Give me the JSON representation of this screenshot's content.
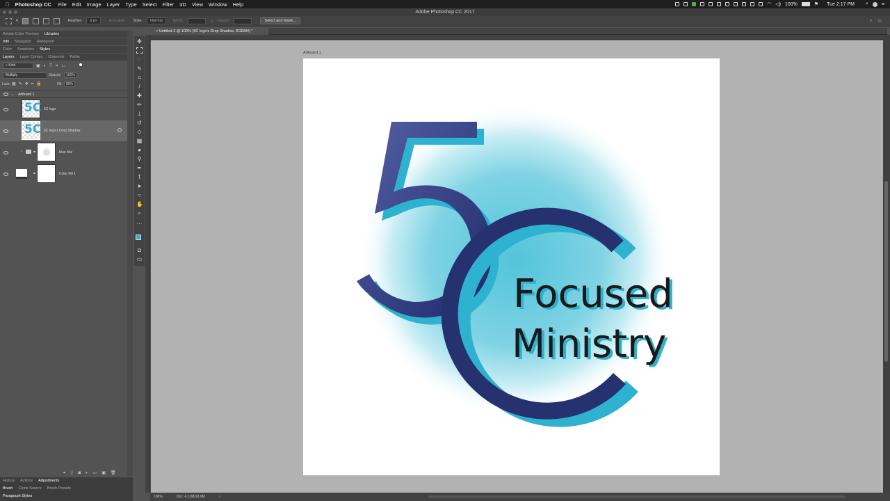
{
  "menubar": {
    "app_name": "Photoshop CC",
    "items": [
      "File",
      "Edit",
      "Image",
      "Layer",
      "Type",
      "Select",
      "Filter",
      "3D",
      "View",
      "Window",
      "Help"
    ],
    "battery": "100%",
    "clock": "Tue 2:17 PM"
  },
  "window": {
    "title": "Adobe Photoshop CC 2017"
  },
  "options_bar": {
    "feather_label": "Feather:",
    "feather_value": "0 px",
    "antialias_label": "Anti-alias",
    "style_label": "Style:",
    "style_value": "Normal",
    "width_label": "Width:",
    "height_label": "Height:",
    "select_mask_label": "Select and Mask..."
  },
  "left_panel": {
    "row1_tabs": [
      "Adobe Color Themes",
      "Libraries"
    ],
    "row2_tabs": [
      "Info",
      "Navigator",
      "Histogram"
    ],
    "row3_tabs": [
      "Color",
      "Swatches",
      "Styles"
    ],
    "row4_tabs": [
      "Layers",
      "Layer Comps",
      "Channels",
      "Paths"
    ],
    "kind_label": "Kind",
    "blend_mode": "Multiply",
    "opacity_label": "Opacity:",
    "opacity_value": "100%",
    "lock_label": "Lock:",
    "fill_label": "Fill:",
    "fill_value": "85%",
    "artboard_name": "Artboard 1",
    "layers": [
      {
        "name": "5C logo"
      },
      {
        "name": "5C logo's Drop Shadow"
      },
      {
        "name": "blue blur"
      },
      {
        "name": "Color Fill 1"
      }
    ],
    "bottom_tabs_1": [
      "History",
      "Actions",
      "Adjustments"
    ],
    "bottom_tabs_2": [
      "Brush",
      "Clone Source",
      "Brush Presets"
    ],
    "bottom_tabs_3": [
      "Paragraph Styles"
    ]
  },
  "document": {
    "tab_title": "Untitled-2 @ 100% (5C logo's Drop Shadow, RGB/8#) *",
    "artboard_label": "Artboard 1",
    "zoom": "100%",
    "doc_size": "Doc: 4.12M/18.9M"
  },
  "artwork": {
    "numeral_5": "5",
    "numeral_c": "C",
    "line1": "Focused",
    "line2": "Ministry"
  },
  "colors": {
    "navy": "#2a3577",
    "cyan": "#2fb2cf",
    "blur": "#7fd3e3"
  }
}
